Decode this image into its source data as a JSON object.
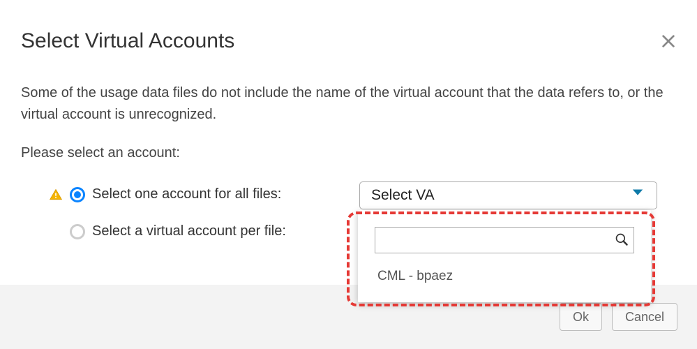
{
  "title": "Select Virtual Accounts",
  "description": "Some of the usage data files do not include the name of the virtual account that the data refers to, or the virtual account is unrecognized.",
  "prompt": "Please select an account:",
  "radios": {
    "all_files": "Select one account for all files:",
    "per_file": "Select a virtual account per file:"
  },
  "select": {
    "placeholder": "Select VA"
  },
  "dropdown": {
    "search_value": "",
    "items": [
      "CML - bpaez"
    ]
  },
  "footer": {
    "ok": "Ok",
    "cancel": "Cancel"
  }
}
